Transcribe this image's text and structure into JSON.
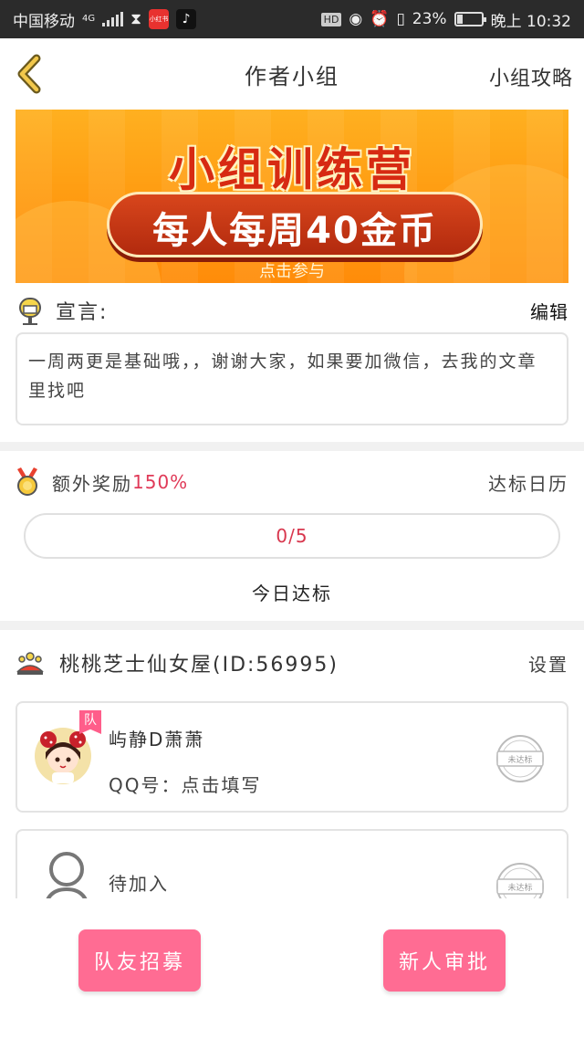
{
  "status_bar": {
    "carrier": "中国移动",
    "network": "4G",
    "app_icon_1": "小红书",
    "app_icon_2": "♪",
    "hd": "HD",
    "battery_pct": "23%",
    "battery_level": 0.23,
    "time": "晚上 10:32"
  },
  "nav": {
    "title": "作者小组",
    "right_link": "小组攻略",
    "back_icon": "chevron-left-icon"
  },
  "banner": {
    "title": "小组训练营",
    "subtitle": "每人每周40金币",
    "cta": "点击参与"
  },
  "declaration": {
    "label": "宣言:",
    "edit": "编辑",
    "text": "一周两更是基础哦，，谢谢大家，如果要加微信，去我的文章里找吧"
  },
  "reward": {
    "label": "额外奖励",
    "percent": "150%",
    "calendar_link": "达标日历",
    "progress_text": "0/5",
    "progress_value": 0,
    "today_label": "今日达标"
  },
  "group": {
    "name": "桃桃芝士仙女屋(ID:56995)",
    "settings": "设置"
  },
  "members": [
    {
      "badge": "队",
      "name": "屿静D萧萧",
      "qq": "QQ号：点击填写",
      "stamp": "未达标"
    },
    {
      "name": "待加入",
      "stamp": "未达标"
    }
  ],
  "buttons": {
    "recruit": "队友招募",
    "approve": "新人审批"
  }
}
